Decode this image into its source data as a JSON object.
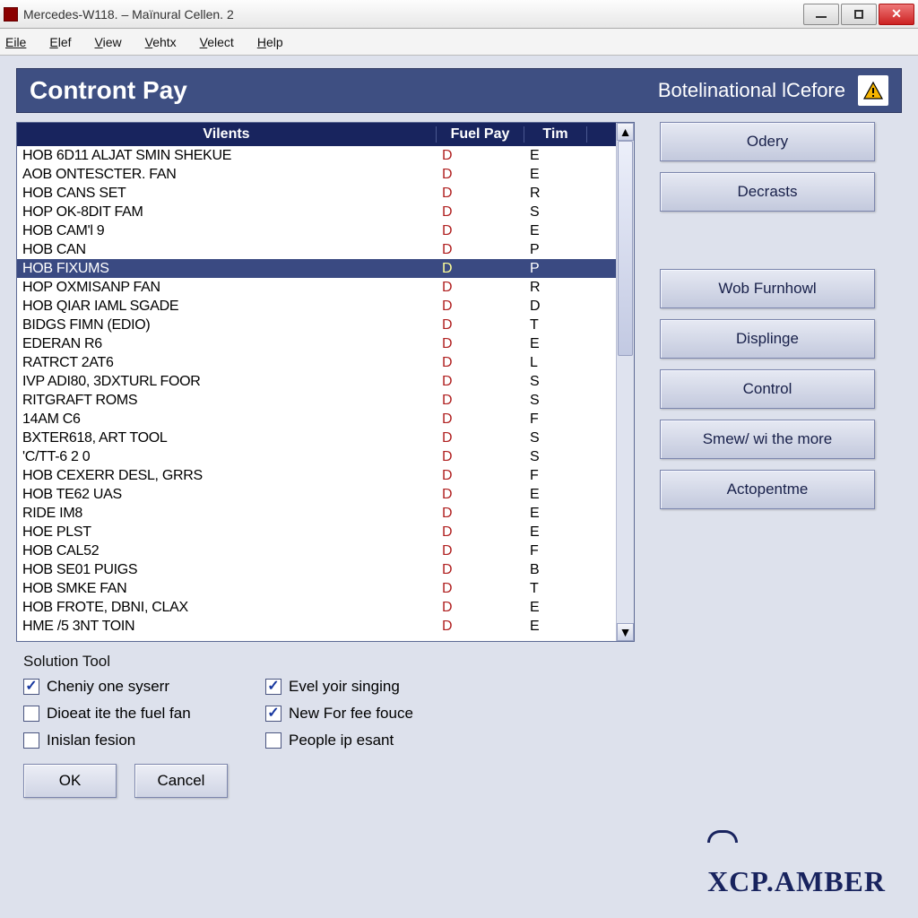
{
  "window": {
    "title": "Mercedes-W118. – Maïnural Cellen. 2"
  },
  "menu": {
    "items": [
      "Eile",
      "Elef",
      "View",
      "Vehtx",
      "Velect",
      "Help"
    ]
  },
  "header": {
    "title": "Contront Pay",
    "subtitle": "Botelinational lCefore"
  },
  "table": {
    "headers": {
      "c1": "Vilents",
      "c2": "Fuel Pay",
      "c3": "Tim"
    },
    "rows": [
      {
        "c1": "HOB 6D11 ALJAT SMIN SHEKUE",
        "c2": "D",
        "c3": "E",
        "sel": false
      },
      {
        "c1": "AOB ONTESCTER. FAN",
        "c2": "D",
        "c3": "E",
        "sel": false
      },
      {
        "c1": "HOB CANS SET",
        "c2": "D",
        "c3": "R",
        "sel": false
      },
      {
        "c1": "HOP OK-8DIT FAM",
        "c2": "D",
        "c3": "S",
        "sel": false
      },
      {
        "c1": "HOB CAM'l 9",
        "c2": "D",
        "c3": "E",
        "sel": false
      },
      {
        "c1": "HOB CAN",
        "c2": "D",
        "c3": "P",
        "sel": false
      },
      {
        "c1": "HOB FIXUMS",
        "c2": "D",
        "c3": "P",
        "sel": true
      },
      {
        "c1": "HOP OXMISANP FAN",
        "c2": "D",
        "c3": "R",
        "sel": false
      },
      {
        "c1": "HOB QIAR IAML SGADE",
        "c2": "D",
        "c3": "D",
        "sel": false
      },
      {
        "c1": "BIDGS FIMN (EDIO)",
        "c2": "D",
        "c3": "T",
        "sel": false
      },
      {
        "c1": "EDERAN R6",
        "c2": "D",
        "c3": "E",
        "sel": false
      },
      {
        "c1": "RATRCT 2AT6",
        "c2": "D",
        "c3": "L",
        "sel": false
      },
      {
        "c1": "IVP ADI80, 3DXTURL FOOR",
        "c2": "D",
        "c3": "S",
        "sel": false
      },
      {
        "c1": "RITGRAFT ROMS",
        "c2": "D",
        "c3": "S",
        "sel": false
      },
      {
        "c1": "14AM C6",
        "c2": "D",
        "c3": "F",
        "sel": false
      },
      {
        "c1": "BXTER618, ART TOOL",
        "c2": "D",
        "c3": "S",
        "sel": false
      },
      {
        "c1": "'C/TT-6 2 0",
        "c2": "D",
        "c3": "S",
        "sel": false
      },
      {
        "c1": "HOB CEXERR DESL, GRRS",
        "c2": "D",
        "c3": "F",
        "sel": false
      },
      {
        "c1": "HOB TE62 UAS",
        "c2": "D",
        "c3": "E",
        "sel": false
      },
      {
        "c1": "RIDE IM8",
        "c2": "D",
        "c3": "E",
        "sel": false
      },
      {
        "c1": "HOE PLST",
        "c2": "D",
        "c3": "E",
        "sel": false
      },
      {
        "c1": "HOB CAL52",
        "c2": "D",
        "c3": "F",
        "sel": false
      },
      {
        "c1": "HOB SE01 PUIGS",
        "c2": "D",
        "c3": "B",
        "sel": false
      },
      {
        "c1": "HOB SMKE FAN",
        "c2": "D",
        "c3": "T",
        "sel": false
      },
      {
        "c1": "HOB FROTE, DBNI, CLAX",
        "c2": "D",
        "c3": "E",
        "sel": false
      },
      {
        "c1": "HME /5 3NT TOIN",
        "c2": "D",
        "c3": "E",
        "sel": false
      }
    ]
  },
  "side_buttons": {
    "b1": "Odery",
    "b2": "Decrasts",
    "b3": "Wob Furnhowl",
    "b4": "Displinge",
    "b5": "Control",
    "b6": "Smew/ wi the more",
    "b7": "Actopentme"
  },
  "footer": {
    "title": "Solution Tool",
    "checks": {
      "c1": {
        "label": "Cheniy one syserr",
        "checked": true
      },
      "c2": {
        "label": "Evel yoir singing",
        "checked": true
      },
      "c3": {
        "label": "Dioeat ite the fuel fan",
        "checked": false
      },
      "c4": {
        "label": "New For fee fouce",
        "checked": true
      },
      "c5": {
        "label": "Inislan fesion",
        "checked": false
      },
      "c6": {
        "label": "People ip esant",
        "checked": false
      }
    },
    "ok": "OK",
    "cancel": "Cancel"
  },
  "brand": "XCP.AMBER"
}
